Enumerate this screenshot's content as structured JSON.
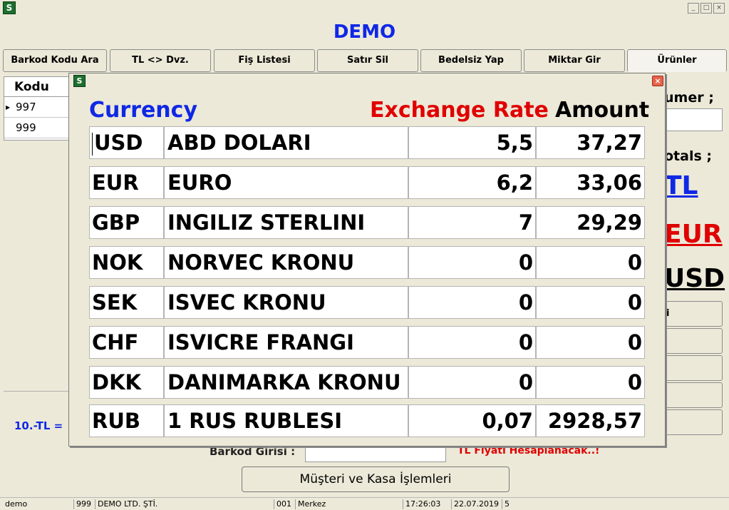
{
  "window": {
    "icon": "app-logo-icon",
    "title": "DEMO",
    "controls": [
      "_",
      "□",
      "×"
    ]
  },
  "toolbar": [
    {
      "label": "Barkod Kodu Ara"
    },
    {
      "label": "TL <> Dvz."
    },
    {
      "label": "Fiş Listesi"
    },
    {
      "label": "Satır Sil"
    },
    {
      "label": "Bedelsiz Yap"
    },
    {
      "label": "Miktar Gir"
    },
    {
      "label": "Ürünler"
    }
  ],
  "grid": {
    "header": "Kodu",
    "rows": [
      "997",
      "999"
    ]
  },
  "left_panel": {
    "rate_label": "10.-TL ="
  },
  "right_panel": {
    "customer_label": "umer ;",
    "totals_label": "otals ;",
    "total_tl": "TL",
    "total_eur": "EUR",
    "total_usd": "USD",
    "side_button_label": "i"
  },
  "dialog": {
    "icon": "app-logo-icon",
    "close": "×",
    "headers": {
      "currency": "Currency",
      "rate": "Exchange Rate",
      "amount": "Amount"
    },
    "rows": [
      {
        "code": "USD",
        "name": "ABD DOLARI",
        "rate": "5,5",
        "amount": "37,27"
      },
      {
        "code": "EUR",
        "name": "EURO",
        "rate": "6,2",
        "amount": "33,06"
      },
      {
        "code": "GBP",
        "name": "INGILIZ STERLINI",
        "rate": "7",
        "amount": "29,29"
      },
      {
        "code": "NOK",
        "name": "NORVEC KRONU",
        "rate": "0",
        "amount": "0"
      },
      {
        "code": "SEK",
        "name": "ISVEC KRONU",
        "rate": "0",
        "amount": "0"
      },
      {
        "code": "CHF",
        "name": "ISVICRE FRANGI",
        "rate": "0",
        "amount": "0"
      },
      {
        "code": "DKK",
        "name": "DANIMARKA KRONU",
        "rate": "0",
        "amount": "0"
      },
      {
        "code": "RUB",
        "name": "1 RUS RUBLESI",
        "rate": "0,07",
        "amount": "2928,57"
      }
    ]
  },
  "bottom": {
    "barcode_label": "Barkod Girisi :",
    "barcode_value": "",
    "tl_note": "TL Fiyatı Hesaplanacak..!",
    "main_button": "Müşteri ve Kasa İşlemleri"
  },
  "statusbar": {
    "user": "demo",
    "code": "999",
    "company": "DEMO LTD. ŞTİ.",
    "branch_code": "001",
    "branch": "Merkez",
    "time": "17:26:03",
    "date": "22.07.2019",
    "extra": "5"
  },
  "colors": {
    "accent_blue": "#0f28e6",
    "accent_red": "#e00000",
    "background": "#ece9d8"
  }
}
